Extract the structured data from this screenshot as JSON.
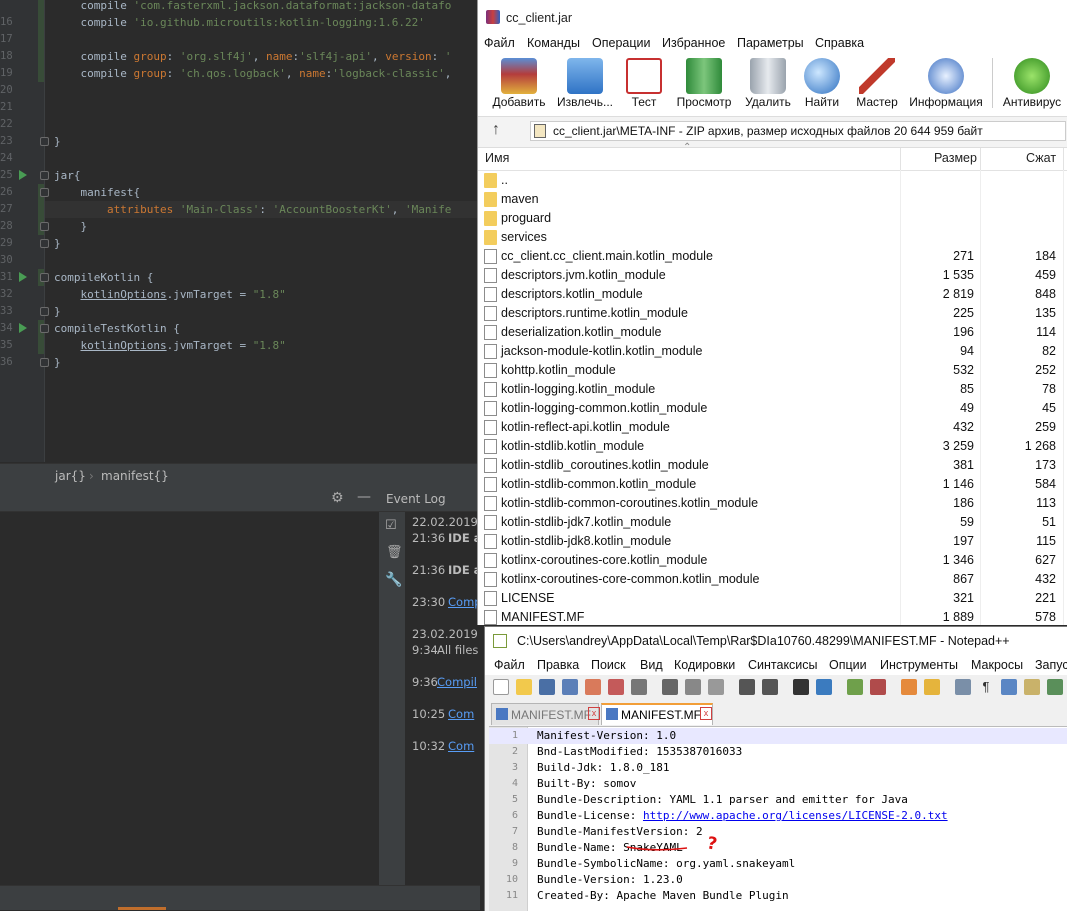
{
  "ide": {
    "code_lines": [
      {
        "n": "",
        "parts": [
          [
            "p",
            "    compile "
          ],
          [
            "s",
            "'com.fasterxml.jackson.dataformat:jackson-datafo"
          ]
        ]
      },
      {
        "n": "16",
        "parts": [
          [
            "p",
            "    compile "
          ],
          [
            "s",
            "'io.github.microutils:kotlin-logging:1.6.22'"
          ]
        ]
      },
      {
        "n": "17",
        "parts": []
      },
      {
        "n": "18",
        "parts": [
          [
            "p",
            "    compile "
          ],
          [
            "k",
            "group"
          ],
          [
            "p",
            ": "
          ],
          [
            "s",
            "'org.slf4j'"
          ],
          [
            "p",
            ", "
          ],
          [
            "k",
            "name"
          ],
          [
            "p",
            ":"
          ],
          [
            "s",
            "'slf4j-api'"
          ],
          [
            "p",
            ", "
          ],
          [
            "k",
            "version"
          ],
          [
            "p",
            ": "
          ],
          [
            "s",
            "'"
          ]
        ]
      },
      {
        "n": "19",
        "parts": [
          [
            "p",
            "    compile "
          ],
          [
            "k",
            "group"
          ],
          [
            "p",
            ": "
          ],
          [
            "s",
            "'ch.qos.logback'"
          ],
          [
            "p",
            ", "
          ],
          [
            "k",
            "name"
          ],
          [
            "p",
            ":"
          ],
          [
            "s",
            "'logback-classic'"
          ],
          [
            "p",
            ","
          ]
        ]
      },
      {
        "n": "20",
        "parts": []
      },
      {
        "n": "21",
        "parts": []
      },
      {
        "n": "22",
        "parts": []
      },
      {
        "n": "23",
        "parts": [
          [
            "p",
            "}"
          ]
        ]
      },
      {
        "n": "24",
        "parts": []
      },
      {
        "n": "25",
        "parts": [
          [
            "p",
            "jar{"
          ]
        ]
      },
      {
        "n": "26",
        "parts": [
          [
            "p",
            "    manifest{"
          ]
        ]
      },
      {
        "n": "27",
        "parts": [
          [
            "p",
            "        "
          ],
          [
            "k",
            "attributes"
          ],
          [
            "p",
            " "
          ],
          [
            "s",
            "'Main-Class'"
          ],
          [
            "p",
            ": "
          ],
          [
            "s",
            "'AccountBoosterKt'"
          ],
          [
            "p",
            ", "
          ],
          [
            "s",
            "'Manife"
          ]
        ]
      },
      {
        "n": "28",
        "parts": [
          [
            "p",
            "    }"
          ]
        ]
      },
      {
        "n": "29",
        "parts": [
          [
            "p",
            "}"
          ]
        ]
      },
      {
        "n": "30",
        "parts": []
      },
      {
        "n": "31",
        "parts": [
          [
            "p",
            "compileKotlin {"
          ]
        ]
      },
      {
        "n": "32",
        "parts": [
          [
            "p",
            "    "
          ],
          [
            "u",
            "kotlinOptions"
          ],
          [
            "p",
            ".jvmTarget = "
          ],
          [
            "s",
            "\"1.8\""
          ]
        ]
      },
      {
        "n": "33",
        "parts": [
          [
            "p",
            "}"
          ]
        ]
      },
      {
        "n": "34",
        "parts": [
          [
            "p",
            "compileTestKotlin {"
          ]
        ]
      },
      {
        "n": "35",
        "parts": [
          [
            "p",
            "    "
          ],
          [
            "u",
            "kotlinOptions"
          ],
          [
            "p",
            ".jvmTarget = "
          ],
          [
            "s",
            "\"1.8\""
          ]
        ]
      },
      {
        "n": "36",
        "parts": [
          [
            "p",
            "}"
          ]
        ]
      }
    ],
    "breadcrumb": [
      "jar{}",
      "manifest{}"
    ],
    "event_log": {
      "title": "Event Log",
      "entries": [
        {
          "date": "22.02.2019",
          "time": "21:36",
          "text": "IDE a",
          "link": false
        },
        {
          "date": "",
          "time": "21:36",
          "text": "IDE a",
          "link": false
        },
        {
          "date": "",
          "time": "23:30",
          "text": "Comp",
          "link": true
        },
        {
          "date": "23.02.2019",
          "time": "9:34",
          "text": "All files",
          "link": false
        },
        {
          "date": "",
          "time": "9:36",
          "text": "Compil",
          "link": true
        },
        {
          "date": "",
          "time": "10:25",
          "text": "Com",
          "link": true
        },
        {
          "date": "",
          "time": "10:32",
          "text": "Com",
          "link": true
        }
      ]
    }
  },
  "winrar": {
    "title": "cc_client.jar",
    "menu": [
      "Файл",
      "Команды",
      "Операции",
      "Избранное",
      "Параметры",
      "Справка"
    ],
    "toolbar": [
      "Добавить",
      "Извлечь...",
      "Тест",
      "Просмотр",
      "Удалить",
      "Найти",
      "Мастер",
      "Информация",
      "Антивирус"
    ],
    "address": "cc_client.jar\\META-INF - ZIP архив, размер исходных файлов 20 644 959 байт",
    "columns": {
      "name": "Имя",
      "size": "Размер",
      "packed": "Сжат"
    },
    "files": [
      {
        "name": "..",
        "type": "folder",
        "size": "",
        "packed": ""
      },
      {
        "name": "maven",
        "type": "folder",
        "size": "",
        "packed": ""
      },
      {
        "name": "proguard",
        "type": "folder",
        "size": "",
        "packed": ""
      },
      {
        "name": "services",
        "type": "folder",
        "size": "",
        "packed": ""
      },
      {
        "name": "cc_client.cc_client.main.kotlin_module",
        "type": "file",
        "size": "271",
        "packed": "184"
      },
      {
        "name": "descriptors.jvm.kotlin_module",
        "type": "file",
        "size": "1 535",
        "packed": "459"
      },
      {
        "name": "descriptors.kotlin_module",
        "type": "file",
        "size": "2 819",
        "packed": "848"
      },
      {
        "name": "descriptors.runtime.kotlin_module",
        "type": "file",
        "size": "225",
        "packed": "135"
      },
      {
        "name": "deserialization.kotlin_module",
        "type": "file",
        "size": "196",
        "packed": "114"
      },
      {
        "name": "jackson-module-kotlin.kotlin_module",
        "type": "file",
        "size": "94",
        "packed": "82"
      },
      {
        "name": "kohttp.kotlin_module",
        "type": "file",
        "size": "532",
        "packed": "252"
      },
      {
        "name": "kotlin-logging.kotlin_module",
        "type": "file",
        "size": "85",
        "packed": "78"
      },
      {
        "name": "kotlin-logging-common.kotlin_module",
        "type": "file",
        "size": "49",
        "packed": "45"
      },
      {
        "name": "kotlin-reflect-api.kotlin_module",
        "type": "file",
        "size": "432",
        "packed": "259"
      },
      {
        "name": "kotlin-stdlib.kotlin_module",
        "type": "file",
        "size": "3 259",
        "packed": "1 268"
      },
      {
        "name": "kotlin-stdlib_coroutines.kotlin_module",
        "type": "file",
        "size": "381",
        "packed": "173"
      },
      {
        "name": "kotlin-stdlib-common.kotlin_module",
        "type": "file",
        "size": "1 146",
        "packed": "584"
      },
      {
        "name": "kotlin-stdlib-common-coroutines.kotlin_module",
        "type": "file",
        "size": "186",
        "packed": "113"
      },
      {
        "name": "kotlin-stdlib-jdk7.kotlin_module",
        "type": "file",
        "size": "59",
        "packed": "51"
      },
      {
        "name": "kotlin-stdlib-jdk8.kotlin_module",
        "type": "file",
        "size": "197",
        "packed": "115"
      },
      {
        "name": "kotlinx-coroutines-core.kotlin_module",
        "type": "file",
        "size": "1 346",
        "packed": "627"
      },
      {
        "name": "kotlinx-coroutines-core-common.kotlin_module",
        "type": "file",
        "size": "867",
        "packed": "432"
      },
      {
        "name": "LICENSE",
        "type": "file",
        "size": "321",
        "packed": "221"
      },
      {
        "name": "MANIFEST.MF",
        "type": "file",
        "size": "1 889",
        "packed": "578"
      }
    ]
  },
  "notepad": {
    "title": "C:\\Users\\andrey\\AppData\\Local\\Temp\\Rar$DIa10760.48299\\MANIFEST.MF - Notepad++",
    "menu": [
      "Файл",
      "Правка",
      "Поиск",
      "Вид",
      "Кодировки",
      "Синтаксисы",
      "Опции",
      "Инструменты",
      "Макросы",
      "Запус"
    ],
    "tabs": [
      "MANIFEST.MF",
      "MANIFEST.MF"
    ],
    "lines": [
      {
        "n": "1",
        "text": "Manifest-Version: 1.0",
        "link": ""
      },
      {
        "n": "2",
        "text": "Bnd-LastModified: 1535387016033",
        "link": ""
      },
      {
        "n": "3",
        "text": "Build-Jdk: 1.8.0_181",
        "link": ""
      },
      {
        "n": "4",
        "text": "Built-By: somov",
        "link": ""
      },
      {
        "n": "5",
        "text": "Bundle-Description: YAML 1.1 parser and emitter for Java",
        "link": ""
      },
      {
        "n": "6",
        "text": "Bundle-License: ",
        "link": "http://www.apache.org/licenses/LICENSE-2.0.txt"
      },
      {
        "n": "7",
        "text": "Bundle-ManifestVersion: 2",
        "link": ""
      },
      {
        "n": "8",
        "text": "Bundle-Name: SnakeYAML",
        "link": ""
      },
      {
        "n": "9",
        "text": "Bundle-SymbolicName: org.yaml.snakeyaml",
        "link": ""
      },
      {
        "n": "10",
        "text": "Bundle-Version: 1.23.0",
        "link": ""
      },
      {
        "n": "11",
        "text": "Created-By: Apache Maven Bundle Plugin",
        "link": ""
      }
    ],
    "annotation": "?"
  }
}
